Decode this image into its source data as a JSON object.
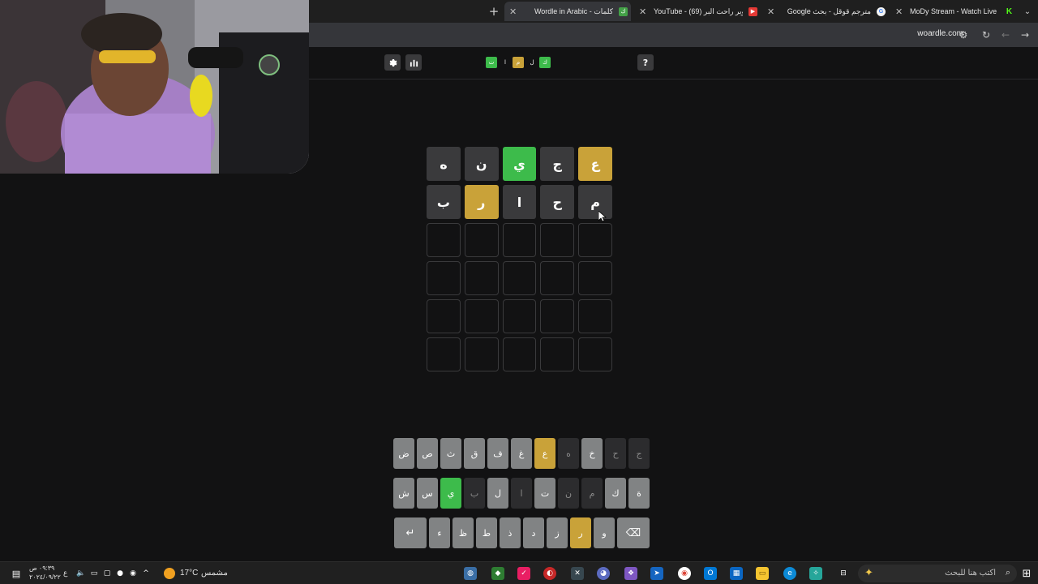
{
  "browser": {
    "tabs": [
      {
        "title": "Wordle in Arabic - كلمات",
        "favicon": "wordle-favicon",
        "active": true
      },
      {
        "title": "YouTube - (69) سوير راحت البر",
        "favicon": "youtube-favicon",
        "active": false
      },
      {
        "title": "Google مترجم قوقل - بحث",
        "favicon": "google-favicon",
        "active": false
      },
      {
        "title": "MoDy Stream - Watch Live on",
        "favicon": "kick-favicon",
        "active": false
      }
    ],
    "new_tab_symbol": "+",
    "close_symbol": "✕",
    "url": "woardle.com"
  },
  "header": {
    "settings_icon": "gear-icon",
    "stats_icon": "bar-chart-icon",
    "help_label": "?",
    "logo": [
      {
        "letter": "ت",
        "state": "correct"
      },
      {
        "letter": "ا",
        "state": "plain"
      },
      {
        "letter": "م",
        "state": "present"
      },
      {
        "letter": "ل",
        "state": "plain"
      },
      {
        "letter": "ك",
        "state": "correct"
      }
    ]
  },
  "board": {
    "rows": [
      [
        {
          "letter": "ع",
          "state": "present"
        },
        {
          "letter": "ج",
          "state": "absent"
        },
        {
          "letter": "ي",
          "state": "correct"
        },
        {
          "letter": "ن",
          "state": "absent"
        },
        {
          "letter": "ه",
          "state": "absent"
        }
      ],
      [
        {
          "letter": "م",
          "state": "absent"
        },
        {
          "letter": "ح",
          "state": "absent"
        },
        {
          "letter": "ا",
          "state": "absent"
        },
        {
          "letter": "ر",
          "state": "present"
        },
        {
          "letter": "ب",
          "state": "absent"
        }
      ],
      [
        {
          "letter": "",
          "state": "empty"
        },
        {
          "letter": "",
          "state": "empty"
        },
        {
          "letter": "",
          "state": "empty"
        },
        {
          "letter": "",
          "state": "empty"
        },
        {
          "letter": "",
          "state": "empty"
        }
      ],
      [
        {
          "letter": "",
          "state": "empty"
        },
        {
          "letter": "",
          "state": "empty"
        },
        {
          "letter": "",
          "state": "empty"
        },
        {
          "letter": "",
          "state": "empty"
        },
        {
          "letter": "",
          "state": "empty"
        }
      ],
      [
        {
          "letter": "",
          "state": "empty"
        },
        {
          "letter": "",
          "state": "empty"
        },
        {
          "letter": "",
          "state": "empty"
        },
        {
          "letter": "",
          "state": "empty"
        },
        {
          "letter": "",
          "state": "empty"
        }
      ],
      [
        {
          "letter": "",
          "state": "empty"
        },
        {
          "letter": "",
          "state": "empty"
        },
        {
          "letter": "",
          "state": "empty"
        },
        {
          "letter": "",
          "state": "empty"
        },
        {
          "letter": "",
          "state": "empty"
        }
      ]
    ]
  },
  "keyboard": {
    "rows": [
      [
        {
          "key": "ج",
          "state": "absent"
        },
        {
          "key": "ح",
          "state": "absent"
        },
        {
          "key": "خ",
          "state": "unused"
        },
        {
          "key": "ه",
          "state": "absent"
        },
        {
          "key": "ع",
          "state": "present"
        },
        {
          "key": "غ",
          "state": "unused"
        },
        {
          "key": "ف",
          "state": "unused"
        },
        {
          "key": "ق",
          "state": "unused"
        },
        {
          "key": "ث",
          "state": "unused"
        },
        {
          "key": "ص",
          "state": "unused"
        },
        {
          "key": "ض",
          "state": "unused"
        }
      ],
      [
        {
          "key": "ة",
          "state": "unused"
        },
        {
          "key": "ك",
          "state": "unused"
        },
        {
          "key": "م",
          "state": "absent"
        },
        {
          "key": "ن",
          "state": "absent"
        },
        {
          "key": "ت",
          "state": "unused"
        },
        {
          "key": "ا",
          "state": "absent"
        },
        {
          "key": "ل",
          "state": "unused"
        },
        {
          "key": "ب",
          "state": "absent"
        },
        {
          "key": "ي",
          "state": "correct"
        },
        {
          "key": "س",
          "state": "unused"
        },
        {
          "key": "ش",
          "state": "unused"
        }
      ],
      [
        {
          "key": "⌫",
          "state": "unused",
          "wide": true,
          "name": "backspace-key"
        },
        {
          "key": "و",
          "state": "unused"
        },
        {
          "key": "ر",
          "state": "present"
        },
        {
          "key": "ز",
          "state": "unused"
        },
        {
          "key": "د",
          "state": "unused"
        },
        {
          "key": "ذ",
          "state": "unused"
        },
        {
          "key": "ط",
          "state": "unused"
        },
        {
          "key": "ظ",
          "state": "unused"
        },
        {
          "key": "ء",
          "state": "unused"
        },
        {
          "key": "↵",
          "state": "unused",
          "wide": true,
          "name": "enter-key"
        }
      ]
    ]
  },
  "taskbar": {
    "search_placeholder": "اكتب هنا للبحث",
    "weather_temp": "17°C",
    "weather_label": "مشمس",
    "clock_time": "٠٩:٣٩ ص",
    "clock_date": "٢٠٢٤/٠٩/٢٢",
    "lang": "ع"
  },
  "colors": {
    "correct": "#3dbb4b",
    "present": "#c9a239",
    "absent": "#3a3a3c",
    "background": "#121213"
  }
}
